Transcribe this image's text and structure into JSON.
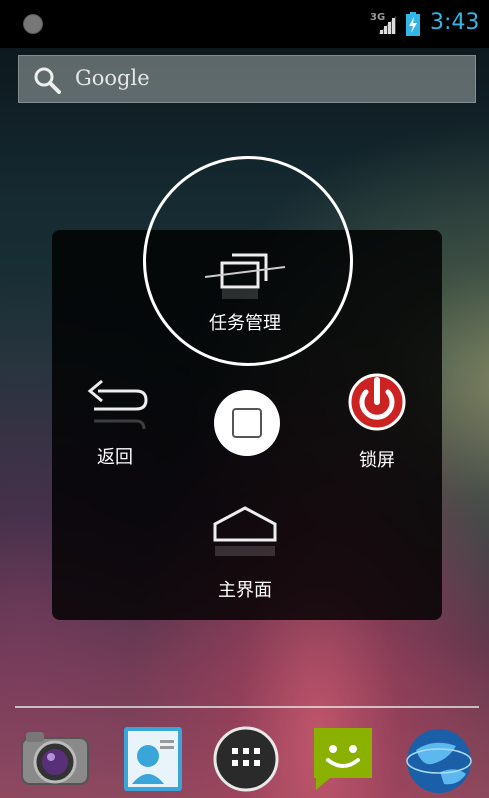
{
  "status_bar": {
    "network": "3G",
    "time": "3:43",
    "icons": [
      "notification-dot-icon",
      "signal-icon",
      "battery-charging-icon"
    ]
  },
  "search": {
    "label": "Google",
    "icon": "search-icon"
  },
  "assist_menu": {
    "items": [
      {
        "id": "task_manager",
        "label": "任务管理",
        "icon": "recent-apps-icon"
      },
      {
        "id": "back",
        "label": "返回",
        "icon": "back-arrow-icon"
      },
      {
        "id": "lock_screen",
        "label": "锁屏",
        "icon": "power-icon"
      },
      {
        "id": "home",
        "label": "主界面",
        "icon": "home-icon"
      }
    ],
    "center_icon": "square-icon"
  },
  "dock": {
    "apps": [
      {
        "icon": "camera-icon"
      },
      {
        "icon": "contacts-icon"
      },
      {
        "icon": "all-apps-icon"
      },
      {
        "icon": "messaging-icon"
      },
      {
        "icon": "browser-globe-icon"
      }
    ]
  },
  "colors": {
    "clock": "#33b5e5",
    "lock_red": "#cc2222",
    "messaging_green": "#8ab000"
  }
}
